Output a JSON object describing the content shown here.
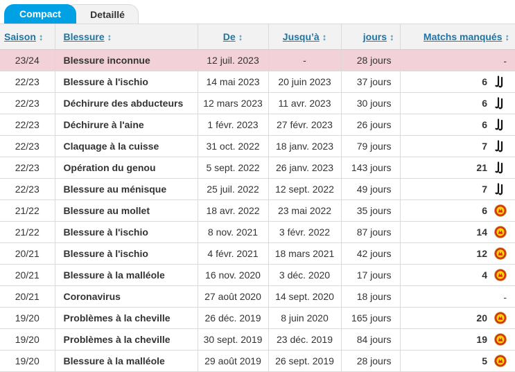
{
  "tabs": [
    {
      "label": "Compact",
      "active": false
    },
    {
      "label": "Detaillé",
      "active": true
    }
  ],
  "columns": {
    "season": "Saison",
    "injury": "Blessure",
    "from": "De",
    "until": "Jusqu’à",
    "days": "jours",
    "games": "Matchs manqués"
  },
  "sort_glyph": "↕",
  "club_icons": {
    "juventus": "juventus-crest-icon",
    "manutd": "manchester-united-crest-icon"
  },
  "rows": [
    {
      "season": "23/24",
      "injury": "Blessure inconnue",
      "from": "12 juil. 2023",
      "until": "-",
      "days": "28 jours",
      "games": "-",
      "club": "",
      "highlight": true
    },
    {
      "season": "22/23",
      "injury": "Blessure à l'ischio",
      "from": "14 mai 2023",
      "until": "20 juin 2023",
      "days": "37 jours",
      "games": "6",
      "club": "juventus"
    },
    {
      "season": "22/23",
      "injury": "Déchirure des abducteurs",
      "from": "12 mars 2023",
      "until": "11 avr. 2023",
      "days": "30 jours",
      "games": "6",
      "club": "juventus"
    },
    {
      "season": "22/23",
      "injury": "Déchirure à l'aine",
      "from": "1 févr. 2023",
      "until": "27 févr. 2023",
      "days": "26 jours",
      "games": "6",
      "club": "juventus"
    },
    {
      "season": "22/23",
      "injury": "Claquage à la cuisse",
      "from": "31 oct. 2022",
      "until": "18 janv. 2023",
      "days": "79 jours",
      "games": "7",
      "club": "juventus"
    },
    {
      "season": "22/23",
      "injury": "Opération du genou",
      "from": "5 sept. 2022",
      "until": "26 janv. 2023",
      "days": "143 jours",
      "games": "21",
      "club": "juventus"
    },
    {
      "season": "22/23",
      "injury": "Blessure au ménisque",
      "from": "25 juil. 2022",
      "until": "12 sept. 2022",
      "days": "49 jours",
      "games": "7",
      "club": "juventus"
    },
    {
      "season": "21/22",
      "injury": "Blessure au mollet",
      "from": "18 avr. 2022",
      "until": "23 mai 2022",
      "days": "35 jours",
      "games": "6",
      "club": "manutd"
    },
    {
      "season": "21/22",
      "injury": "Blessure à l'ischio",
      "from": "8 nov. 2021",
      "until": "3 févr. 2022",
      "days": "87 jours",
      "games": "14",
      "club": "manutd"
    },
    {
      "season": "20/21",
      "injury": "Blessure à l'ischio",
      "from": "4 févr. 2021",
      "until": "18 mars 2021",
      "days": "42 jours",
      "games": "12",
      "club": "manutd"
    },
    {
      "season": "20/21",
      "injury": "Blessure à la malléole",
      "from": "16 nov. 2020",
      "until": "3 déc. 2020",
      "days": "17 jours",
      "games": "4",
      "club": "manutd"
    },
    {
      "season": "20/21",
      "injury": "Coronavirus",
      "from": "27 août 2020",
      "until": "14 sept. 2020",
      "days": "18 jours",
      "games": "-",
      "club": ""
    },
    {
      "season": "19/20",
      "injury": "Problèmes à la cheville",
      "from": "26 déc. 2019",
      "until": "8 juin 2020",
      "days": "165 jours",
      "games": "20",
      "club": "manutd"
    },
    {
      "season": "19/20",
      "injury": "Problèmes à la cheville",
      "from": "30 sept. 2019",
      "until": "23 déc. 2019",
      "days": "84 jours",
      "games": "19",
      "club": "manutd"
    },
    {
      "season": "19/20",
      "injury": "Blessure à la malléole",
      "from": "29 août 2019",
      "until": "26 sept. 2019",
      "days": "28 jours",
      "games": "5",
      "club": "manutd"
    }
  ],
  "colors": {
    "accent": "#00a1e4",
    "link": "#1d75a3",
    "highlight_row": "#f2d2d8",
    "header_bg": "#f2f2f2"
  }
}
